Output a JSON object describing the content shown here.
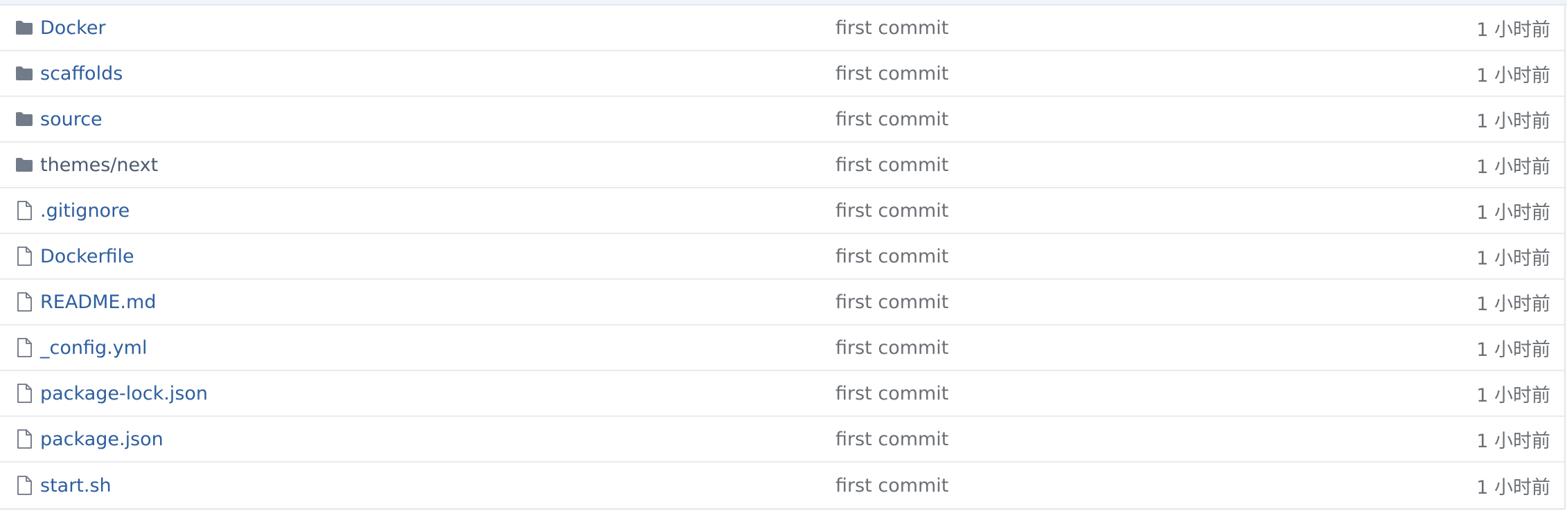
{
  "files": [
    {
      "name": "Docker",
      "type": "folder",
      "icon": "folder-icon",
      "commit": "first commit",
      "time": "1 小时前"
    },
    {
      "name": "scaffolds",
      "type": "folder",
      "icon": "folder-icon",
      "commit": "first commit",
      "time": "1 小时前"
    },
    {
      "name": "source",
      "type": "folder",
      "icon": "folder-icon",
      "commit": "first commit",
      "time": "1 小时前"
    },
    {
      "name": "themes/next",
      "type": "folder",
      "icon": "folder-icon",
      "commit": "first commit",
      "time": "1 小时前"
    },
    {
      "name": ".gitignore",
      "type": "file",
      "icon": "file-icon",
      "commit": "first commit",
      "time": "1 小时前"
    },
    {
      "name": "Dockerfile",
      "type": "file",
      "icon": "file-icon",
      "commit": "first commit",
      "time": "1 小时前"
    },
    {
      "name": "README.md",
      "type": "file",
      "icon": "file-icon",
      "commit": "first commit",
      "time": "1 小时前"
    },
    {
      "name": "_config.yml",
      "type": "file",
      "icon": "file-icon",
      "commit": "first commit",
      "time": "1 小时前"
    },
    {
      "name": "package-lock.json",
      "type": "file",
      "icon": "file-icon",
      "commit": "first commit",
      "time": "1 小时前"
    },
    {
      "name": "package.json",
      "type": "file",
      "icon": "file-icon",
      "commit": "first commit",
      "time": "1 小时前"
    },
    {
      "name": "start.sh",
      "type": "file",
      "icon": "file-icon",
      "commit": "first commit",
      "time": "1 小时前"
    }
  ],
  "colors": {
    "link": "#2e5e9e",
    "muted": "#6b6f75",
    "folder": "#717b89"
  }
}
